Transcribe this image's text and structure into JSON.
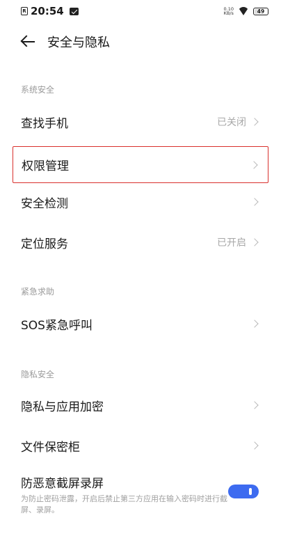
{
  "status_bar": {
    "sim_label": "R",
    "time": "20:54",
    "net_speed_value": "0.10",
    "net_speed_unit": "KB/s",
    "battery": "49",
    "battery_level_percent": 49
  },
  "header": {
    "title": "安全与隐私",
    "back_icon": "arrow-left-icon"
  },
  "sections": [
    {
      "label": "系统安全",
      "items": [
        {
          "label": "查找手机",
          "value": "已关闭"
        },
        {
          "label": "权限管理",
          "value": ""
        },
        {
          "label": "安全检测",
          "value": ""
        },
        {
          "label": "定位服务",
          "value": "已开启"
        }
      ]
    },
    {
      "label": "紧急求助",
      "items": [
        {
          "label": "SOS紧急呼叫",
          "value": ""
        }
      ]
    },
    {
      "label": "隐私安全",
      "items": [
        {
          "label": "隐私与应用加密",
          "value": ""
        },
        {
          "label": "文件保密柜",
          "value": ""
        }
      ]
    }
  ],
  "screen_protect": {
    "title": "防恶意截屏录屏",
    "description": "为防止密码泄露，开启后禁止第三方应用在输入密码时进行截屏、录屏。",
    "enabled": true
  },
  "colors": {
    "highlight_border": "#d9302c",
    "toggle_on": "#3d6bf0",
    "secondary_text": "#a8a8a8"
  }
}
